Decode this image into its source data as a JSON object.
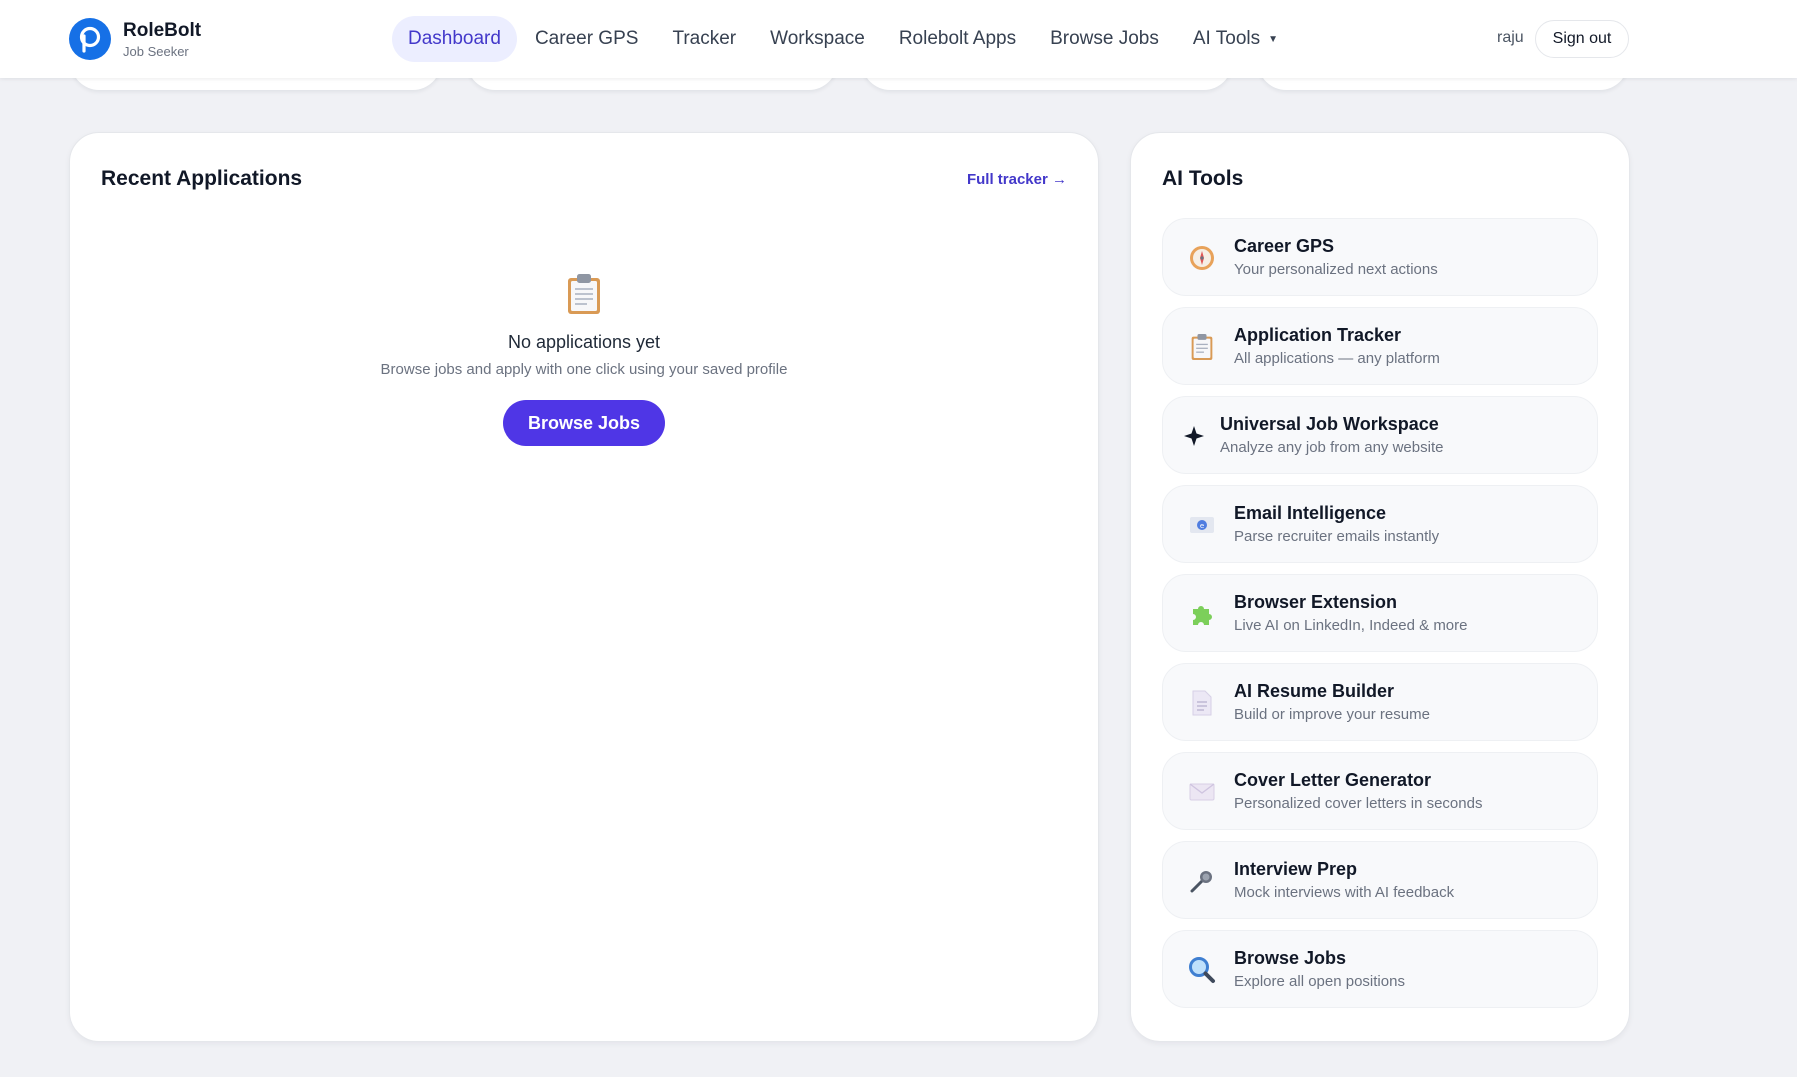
{
  "header": {
    "brand_name": "RoleBolt",
    "brand_sub": "Job Seeker",
    "nav": [
      {
        "label": "Dashboard",
        "active": true
      },
      {
        "label": "Career GPS"
      },
      {
        "label": "Tracker"
      },
      {
        "label": "Workspace"
      },
      {
        "label": "Rolebolt Apps"
      },
      {
        "label": "Browse Jobs"
      },
      {
        "label": "AI Tools",
        "dropdown": true
      }
    ],
    "user": "raju",
    "signout": "Sign out"
  },
  "recent": {
    "title": "Recent Applications",
    "link": "Full tracker →",
    "empty_title": "No applications yet",
    "empty_desc": "Browse jobs and apply with one click using your saved profile",
    "button": "Browse Jobs",
    "empty_icon": "clipboard-icon"
  },
  "ai_tools": {
    "title": "AI Tools",
    "items": [
      {
        "title": "Career GPS",
        "desc": "Your personalized next actions",
        "icon": "compass-icon"
      },
      {
        "title": "Application Tracker",
        "desc": "All applications — any platform",
        "icon": "clipboard-icon"
      },
      {
        "title": "Universal Job Workspace",
        "desc": "Analyze any job from any website",
        "icon": "sparkle-icon"
      },
      {
        "title": "Email Intelligence",
        "desc": "Parse recruiter emails instantly",
        "icon": "email-icon"
      },
      {
        "title": "Browser Extension",
        "desc": "Live AI on LinkedIn, Indeed & more",
        "icon": "puzzle-icon"
      },
      {
        "title": "AI Resume Builder",
        "desc": "Build or improve your resume",
        "icon": "document-icon"
      },
      {
        "title": "Cover Letter Generator",
        "desc": "Personalized cover letters in seconds",
        "icon": "envelope-icon"
      },
      {
        "title": "Interview Prep",
        "desc": "Mock interviews with AI feedback",
        "icon": "microphone-icon"
      },
      {
        "title": "Browse Jobs",
        "desc": "Explore all open positions",
        "icon": "magnifier-icon"
      }
    ]
  },
  "colors": {
    "accent": "#4f36e6",
    "nav_active_bg": "#eceeff",
    "nav_active_text": "#4338ca",
    "logo": "#1670e6",
    "page_bg": "#f0f1f5"
  }
}
